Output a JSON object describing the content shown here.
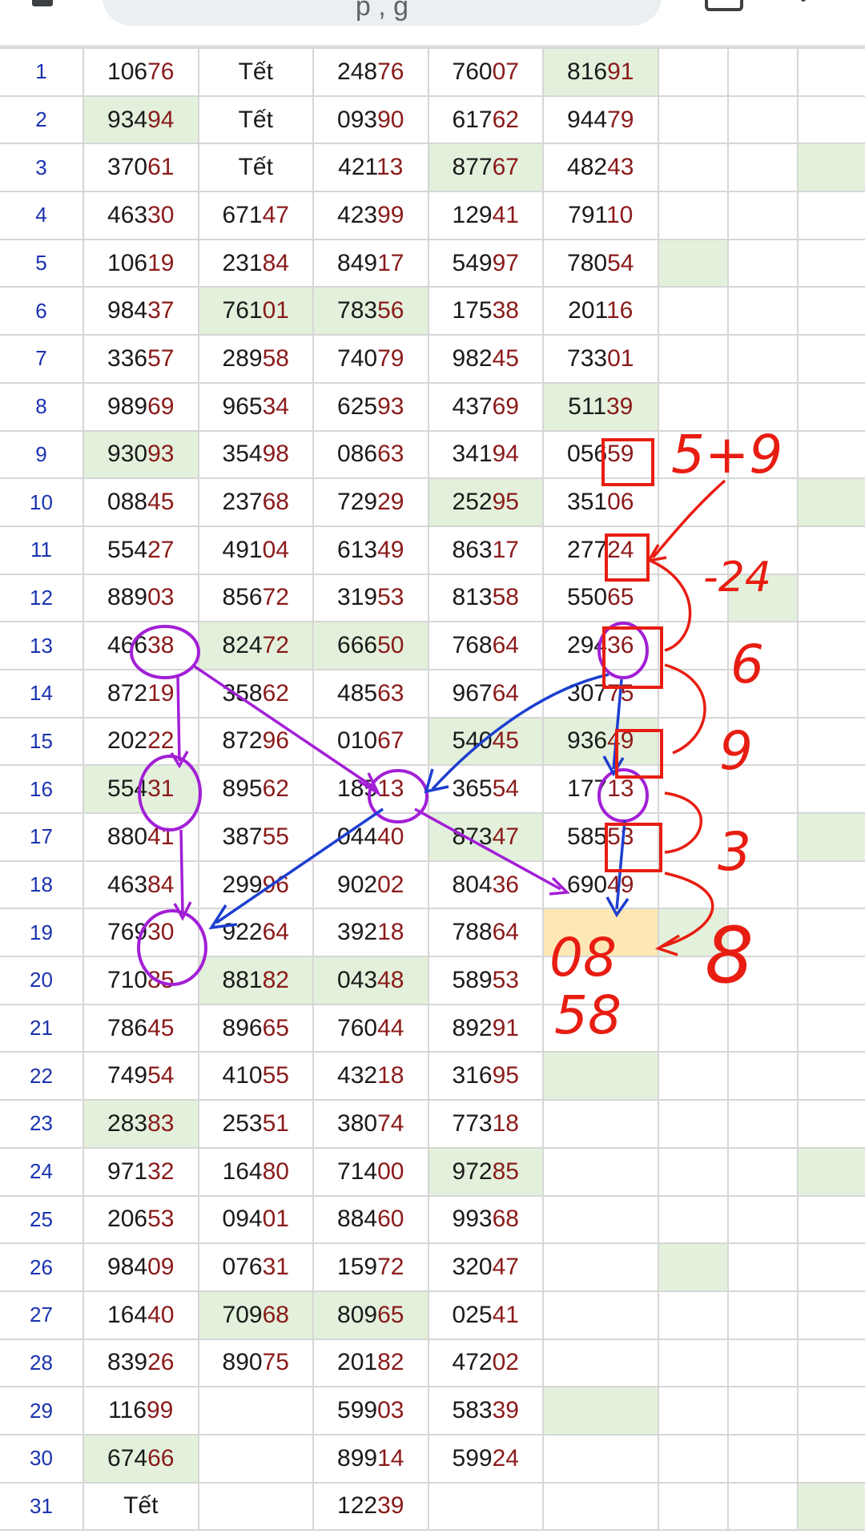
{
  "browser": {
    "search_text": "p      ,      g"
  },
  "table": {
    "rows": [
      {
        "n": "1",
        "cells": [
          [
            "106",
            "76"
          ],
          [
            "Tết",
            ""
          ],
          [
            "248",
            "76"
          ],
          [
            "760",
            "07"
          ],
          [
            "816",
            "91"
          ]
        ],
        "hl": [
          4
        ]
      },
      {
        "n": "2",
        "cells": [
          [
            "934",
            "94"
          ],
          [
            "Tết",
            ""
          ],
          [
            "093",
            "90"
          ],
          [
            "617",
            "62"
          ],
          [
            "944",
            "79"
          ]
        ],
        "hl": [
          0
        ]
      },
      {
        "n": "3",
        "cells": [
          [
            "370",
            "61"
          ],
          [
            "Tết",
            ""
          ],
          [
            "421",
            "13"
          ],
          [
            "877",
            "67"
          ],
          [
            "482",
            "43"
          ]
        ],
        "hl": [
          3,
          7
        ]
      },
      {
        "n": "4",
        "cells": [
          [
            "463",
            "30"
          ],
          [
            "671",
            "47"
          ],
          [
            "423",
            "99"
          ],
          [
            "129",
            "41"
          ],
          [
            "791",
            "10"
          ]
        ],
        "hl": []
      },
      {
        "n": "5",
        "cells": [
          [
            "106",
            "19"
          ],
          [
            "231",
            "84"
          ],
          [
            "849",
            "17"
          ],
          [
            "549",
            "97"
          ],
          [
            "780",
            "54"
          ]
        ],
        "hl": [
          5
        ]
      },
      {
        "n": "6",
        "cells": [
          [
            "984",
            "37"
          ],
          [
            "761",
            "01"
          ],
          [
            "783",
            "56"
          ],
          [
            "175",
            "38"
          ],
          [
            "201",
            "16"
          ]
        ],
        "hl": [
          1,
          2
        ]
      },
      {
        "n": "7",
        "cells": [
          [
            "336",
            "57"
          ],
          [
            "289",
            "58"
          ],
          [
            "740",
            "79"
          ],
          [
            "982",
            "45"
          ],
          [
            "733",
            "01"
          ]
        ],
        "hl": [
          8
        ]
      },
      {
        "n": "8",
        "cells": [
          [
            "989",
            "69"
          ],
          [
            "965",
            "34"
          ],
          [
            "625",
            "93"
          ],
          [
            "437",
            "69"
          ],
          [
            "511",
            "39"
          ]
        ],
        "hl": [
          4
        ]
      },
      {
        "n": "9",
        "cells": [
          [
            "930",
            "93"
          ],
          [
            "354",
            "98"
          ],
          [
            "086",
            "63"
          ],
          [
            "341",
            "94"
          ],
          [
            "056",
            "59"
          ]
        ],
        "hl": [
          0
        ]
      },
      {
        "n": "10",
        "cells": [
          [
            "088",
            "45"
          ],
          [
            "237",
            "68"
          ],
          [
            "729",
            "29"
          ],
          [
            "252",
            "95"
          ],
          [
            "351",
            "06"
          ]
        ],
        "hl": [
          3,
          7
        ]
      },
      {
        "n": "11",
        "cells": [
          [
            "554",
            "27"
          ],
          [
            "491",
            "04"
          ],
          [
            "613",
            "49"
          ],
          [
            "863",
            "17"
          ],
          [
            "277",
            "24"
          ]
        ],
        "hl": []
      },
      {
        "n": "12",
        "cells": [
          [
            "889",
            "03"
          ],
          [
            "856",
            "72"
          ],
          [
            "319",
            "53"
          ],
          [
            "813",
            "58"
          ],
          [
            "550",
            "65"
          ]
        ],
        "hl": [
          6
        ]
      },
      {
        "n": "13",
        "cells": [
          [
            "466",
            "38"
          ],
          [
            "824",
            "72"
          ],
          [
            "666",
            "50"
          ],
          [
            "768",
            "64"
          ],
          [
            "294",
            "36"
          ]
        ],
        "hl": [
          1,
          2
        ]
      },
      {
        "n": "14",
        "cells": [
          [
            "872",
            "19"
          ],
          [
            "358",
            "62"
          ],
          [
            "485",
            "63"
          ],
          [
            "967",
            "64"
          ],
          [
            "307",
            "75"
          ]
        ],
        "hl": [
          8
        ]
      },
      {
        "n": "15",
        "cells": [
          [
            "202",
            "22"
          ],
          [
            "872",
            "96"
          ],
          [
            "010",
            "67"
          ],
          [
            "540",
            "45"
          ],
          [
            "936",
            "49"
          ]
        ],
        "hl": [
          3,
          4
        ]
      },
      {
        "n": "16",
        "cells": [
          [
            "554",
            "31"
          ],
          [
            "895",
            "62"
          ],
          [
            "185",
            "13"
          ],
          [
            "365",
            "54"
          ],
          [
            "177",
            "13"
          ]
        ],
        "hl": [
          0
        ]
      },
      {
        "n": "17",
        "cells": [
          [
            "880",
            "41"
          ],
          [
            "387",
            "55"
          ],
          [
            "044",
            "40"
          ],
          [
            "873",
            "47"
          ],
          [
            "585",
            "53"
          ]
        ],
        "hl": [
          3,
          7
        ]
      },
      {
        "n": "18",
        "cells": [
          [
            "463",
            "84"
          ],
          [
            "299",
            "96"
          ],
          [
            "902",
            "02"
          ],
          [
            "804",
            "36"
          ],
          [
            "690",
            "49"
          ]
        ],
        "hl": []
      },
      {
        "n": "19",
        "cells": [
          [
            "769",
            "30"
          ],
          [
            "922",
            "64"
          ],
          [
            "392",
            "18"
          ],
          [
            "788",
            "64"
          ],
          [
            "",
            ""
          ]
        ],
        "hl": [
          5
        ],
        "warn": [
          4
        ]
      },
      {
        "n": "20",
        "cells": [
          [
            "710",
            "85"
          ],
          [
            "881",
            "82"
          ],
          [
            "043",
            "48"
          ],
          [
            "589",
            "53"
          ],
          [
            "",
            ""
          ]
        ],
        "hl": [
          1,
          2
        ]
      },
      {
        "n": "21",
        "cells": [
          [
            "786",
            "45"
          ],
          [
            "896",
            "65"
          ],
          [
            "760",
            "44"
          ],
          [
            "892",
            "91"
          ],
          [
            "",
            ""
          ]
        ],
        "hl": [
          8
        ]
      },
      {
        "n": "22",
        "cells": [
          [
            "749",
            "54"
          ],
          [
            "410",
            "55"
          ],
          [
            "432",
            "18"
          ],
          [
            "316",
            "95"
          ],
          [
            "",
            ""
          ]
        ],
        "hl": [
          4
        ]
      },
      {
        "n": "23",
        "cells": [
          [
            "283",
            "83"
          ],
          [
            "253",
            "51"
          ],
          [
            "380",
            "74"
          ],
          [
            "773",
            "18"
          ],
          [
            "",
            ""
          ]
        ],
        "hl": [
          0
        ]
      },
      {
        "n": "24",
        "cells": [
          [
            "971",
            "32"
          ],
          [
            "164",
            "80"
          ],
          [
            "714",
            "00"
          ],
          [
            "972",
            "85"
          ],
          [
            "",
            ""
          ]
        ],
        "hl": [
          3,
          7
        ]
      },
      {
        "n": "25",
        "cells": [
          [
            "206",
            "53"
          ],
          [
            "094",
            "01"
          ],
          [
            "884",
            "60"
          ],
          [
            "993",
            "68"
          ],
          [
            "",
            ""
          ]
        ],
        "hl": []
      },
      {
        "n": "26",
        "cells": [
          [
            "984",
            "09"
          ],
          [
            "076",
            "31"
          ],
          [
            "159",
            "72"
          ],
          [
            "320",
            "47"
          ],
          [
            "",
            ""
          ]
        ],
        "hl": [
          5
        ]
      },
      {
        "n": "27",
        "cells": [
          [
            "164",
            "40"
          ],
          [
            "709",
            "68"
          ],
          [
            "809",
            "65"
          ],
          [
            "025",
            "41"
          ],
          [
            "",
            ""
          ]
        ],
        "hl": [
          1,
          2
        ]
      },
      {
        "n": "28",
        "cells": [
          [
            "839",
            "26"
          ],
          [
            "890",
            "75"
          ],
          [
            "201",
            "82"
          ],
          [
            "472",
            "02"
          ],
          [
            "",
            ""
          ]
        ],
        "hl": [
          8
        ]
      },
      {
        "n": "29",
        "cells": [
          [
            "116",
            "99"
          ],
          [
            "",
            ""
          ],
          [
            "599",
            "03"
          ],
          [
            "583",
            "39"
          ],
          [
            "",
            ""
          ]
        ],
        "hl": [
          4
        ]
      },
      {
        "n": "30",
        "cells": [
          [
            "674",
            "66"
          ],
          [
            "",
            ""
          ],
          [
            "899",
            "14"
          ],
          [
            "599",
            "24"
          ],
          [
            "",
            ""
          ]
        ],
        "hl": [
          0
        ]
      },
      {
        "n": "31",
        "cells": [
          [
            "Tết",
            ""
          ],
          [
            "",
            ""
          ],
          [
            "122",
            "39"
          ],
          [
            "",
            ""
          ],
          [
            "",
            ""
          ]
        ],
        "hl": [
          7
        ]
      }
    ]
  },
  "annotations": {
    "red_notes": [
      "5+9",
      "-24",
      "6",
      "9",
      "3",
      "8",
      "08",
      "58"
    ]
  }
}
